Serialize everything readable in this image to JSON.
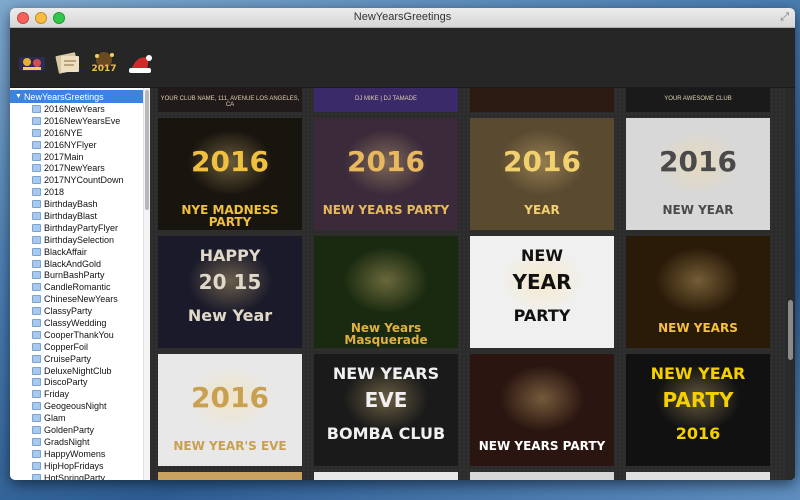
{
  "window": {
    "title": "NewYearsGreetings"
  },
  "toolbar": {
    "tools": [
      {
        "name": "fireworks-thumb-icon"
      },
      {
        "name": "card-icon"
      },
      {
        "name": "year-2017-icon"
      },
      {
        "name": "santa-hat-icon"
      }
    ]
  },
  "sidebar": {
    "root_label": "NewYearsGreetings",
    "items": [
      "2016NewYears",
      "2016NewYearsEve",
      "2016NYE",
      "2016NYFlyer",
      "2017Main",
      "2017NewYears",
      "2017NYCountDown",
      "2018",
      "BirthdayBash",
      "BirthdayBlast",
      "BirthdayPartyFlyer",
      "BirthdaySelection",
      "BlackAffair",
      "BlackAndGold",
      "BurnBashParty",
      "CandleRomantic",
      "ChineseNewYears",
      "ClassyParty",
      "ClassyWedding",
      "CooperThankYou",
      "CopperFoil",
      "CruiseParty",
      "DeluxeNightClub",
      "DiscoParty",
      "Friday",
      "GeogeousNight",
      "Glam",
      "GoldenParty",
      "GradsNight",
      "HappyWomens",
      "HipHopFridays",
      "HotSpringParty"
    ]
  },
  "gallery": {
    "top_row": [
      {
        "text": "YOUR CLUB NAME, 111, AVENUE LOS ANGELES, CA",
        "bg": "#201a1a"
      },
      {
        "text": "DJ MIKE | DJ TAMADE",
        "bg": "#3a2a6a"
      },
      {
        "text": "",
        "bg": "#2a1a10"
      },
      {
        "text": "YOUR AWESOME CLUB",
        "bg": "#1a1a1a"
      }
    ],
    "row1": [
      {
        "big": "2016",
        "sub": "NYE MADNESS PARTY",
        "bg": "#18140e",
        "fg": "#f0c040"
      },
      {
        "big": "2016",
        "sub": "NEW YEARS PARTY",
        "bg": "#3a2a3a",
        "fg": "#e8b860"
      },
      {
        "big": "2016",
        "sub": "YEAR",
        "bg": "#5a4a30",
        "fg": "#f2d070"
      },
      {
        "big": "2016",
        "sub": "NEW YEAR",
        "bg": "#d8d8d8",
        "fg": "#4a4a4a"
      }
    ],
    "row2": [
      {
        "big": "HAPPY",
        "mid": "20 15",
        "sub": "New Year",
        "bg": "#1a1a2a",
        "fg": "#e0d8c8"
      },
      {
        "big": "",
        "sub": "New Years Masquerade",
        "bg": "#1a2a10",
        "fg": "#e0b040"
      },
      {
        "big": "NEW",
        "mid": "YEAR",
        "sub": "PARTY",
        "bg": "#f0f0f0",
        "fg": "#111111"
      },
      {
        "big": "",
        "sub": "NEW YEARS",
        "bg": "#2a1a08",
        "fg": "#f5c040"
      }
    ],
    "row3": [
      {
        "big": "2016",
        "sub": "NEW YEAR'S EVE",
        "bg": "#e8e8e8",
        "fg": "#c8a050"
      },
      {
        "big": "NEW YEARS",
        "mid": "EVE",
        "sub": "BOMBA CLUB",
        "bg": "#1a1a1a",
        "fg": "#f0f0f0"
      },
      {
        "big": "",
        "sub": "NEW YEARS PARTY",
        "bg": "#2a1510",
        "fg": "#ffffff"
      },
      {
        "big": "NEW YEAR",
        "mid": "PARTY",
        "sub": "2016",
        "bg": "#111111",
        "fg": "#f5d000"
      }
    ],
    "bottom_row": [
      {
        "bg": "#c8a060"
      },
      {
        "bg": "#e8e8e8"
      },
      {
        "bg": "#d8d8d8"
      },
      {
        "bg": "#e0e0e0"
      }
    ]
  }
}
